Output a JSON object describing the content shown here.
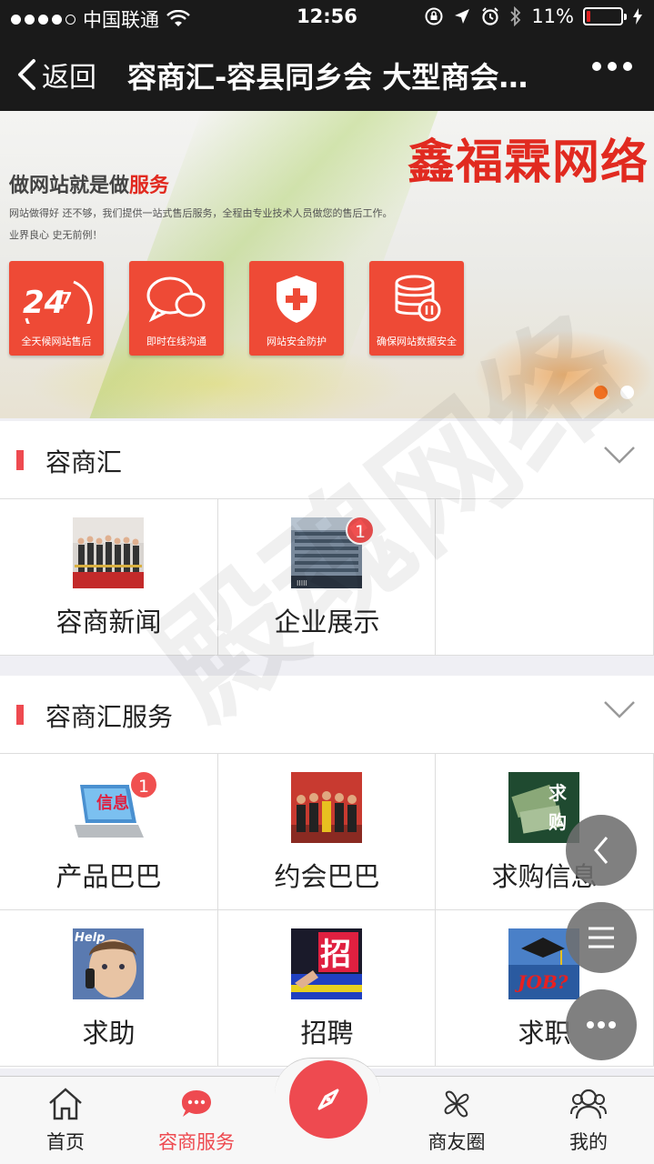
{
  "status_bar": {
    "carrier": "中国联通",
    "time": "12:56",
    "battery": "11%",
    "battery_level": 0.11
  },
  "nav": {
    "back_label": "返回",
    "title": "容商汇-容县同乡会 大型商会…"
  },
  "banner": {
    "brand": "鑫福霖网络",
    "headline_a": "做网站就是做",
    "headline_b": "服务",
    "subtext_1": "网站做得好 还不够，我们提供一站式售后服务，全程由专业技术人员做您的售后工作。",
    "subtext_2": "业界良心 史无前例！",
    "services": [
      {
        "label": "全天候网站售后",
        "icon": "clock-247-icon"
      },
      {
        "label": "即时在线沟通",
        "icon": "chat-bubbles-icon"
      },
      {
        "label": "网站安全防护",
        "icon": "shield-icon"
      },
      {
        "label": "确保网站数据安全",
        "icon": "database-icon"
      }
    ],
    "active_slide": 1,
    "slide_count": 2
  },
  "section1": {
    "title": "容商汇",
    "items": [
      {
        "label": "容商新闻",
        "badge": ""
      },
      {
        "label": "企业展示",
        "badge": "1"
      }
    ]
  },
  "section2": {
    "title": "容商汇服务",
    "items": [
      {
        "label": "产品巴巴",
        "badge": "1"
      },
      {
        "label": "约会巴巴",
        "badge": ""
      },
      {
        "label": "求购信息",
        "badge": ""
      },
      {
        "label": "求助",
        "badge": ""
      },
      {
        "label": "招聘",
        "badge": ""
      },
      {
        "label": "求职",
        "badge": ""
      }
    ]
  },
  "watermark": "殿魂网络",
  "tabs": [
    {
      "label": "首页",
      "icon": "home-icon"
    },
    {
      "label": "容商服务",
      "icon": "chat-icon",
      "active": true
    },
    {
      "label": "商友圈",
      "icon": "pinwheel-icon"
    },
    {
      "label": "我的",
      "icon": "people-icon"
    }
  ],
  "colors": {
    "accent": "#ee4a50",
    "nav_bg": "#1a1a1a",
    "banner_red": "#e12a20"
  }
}
